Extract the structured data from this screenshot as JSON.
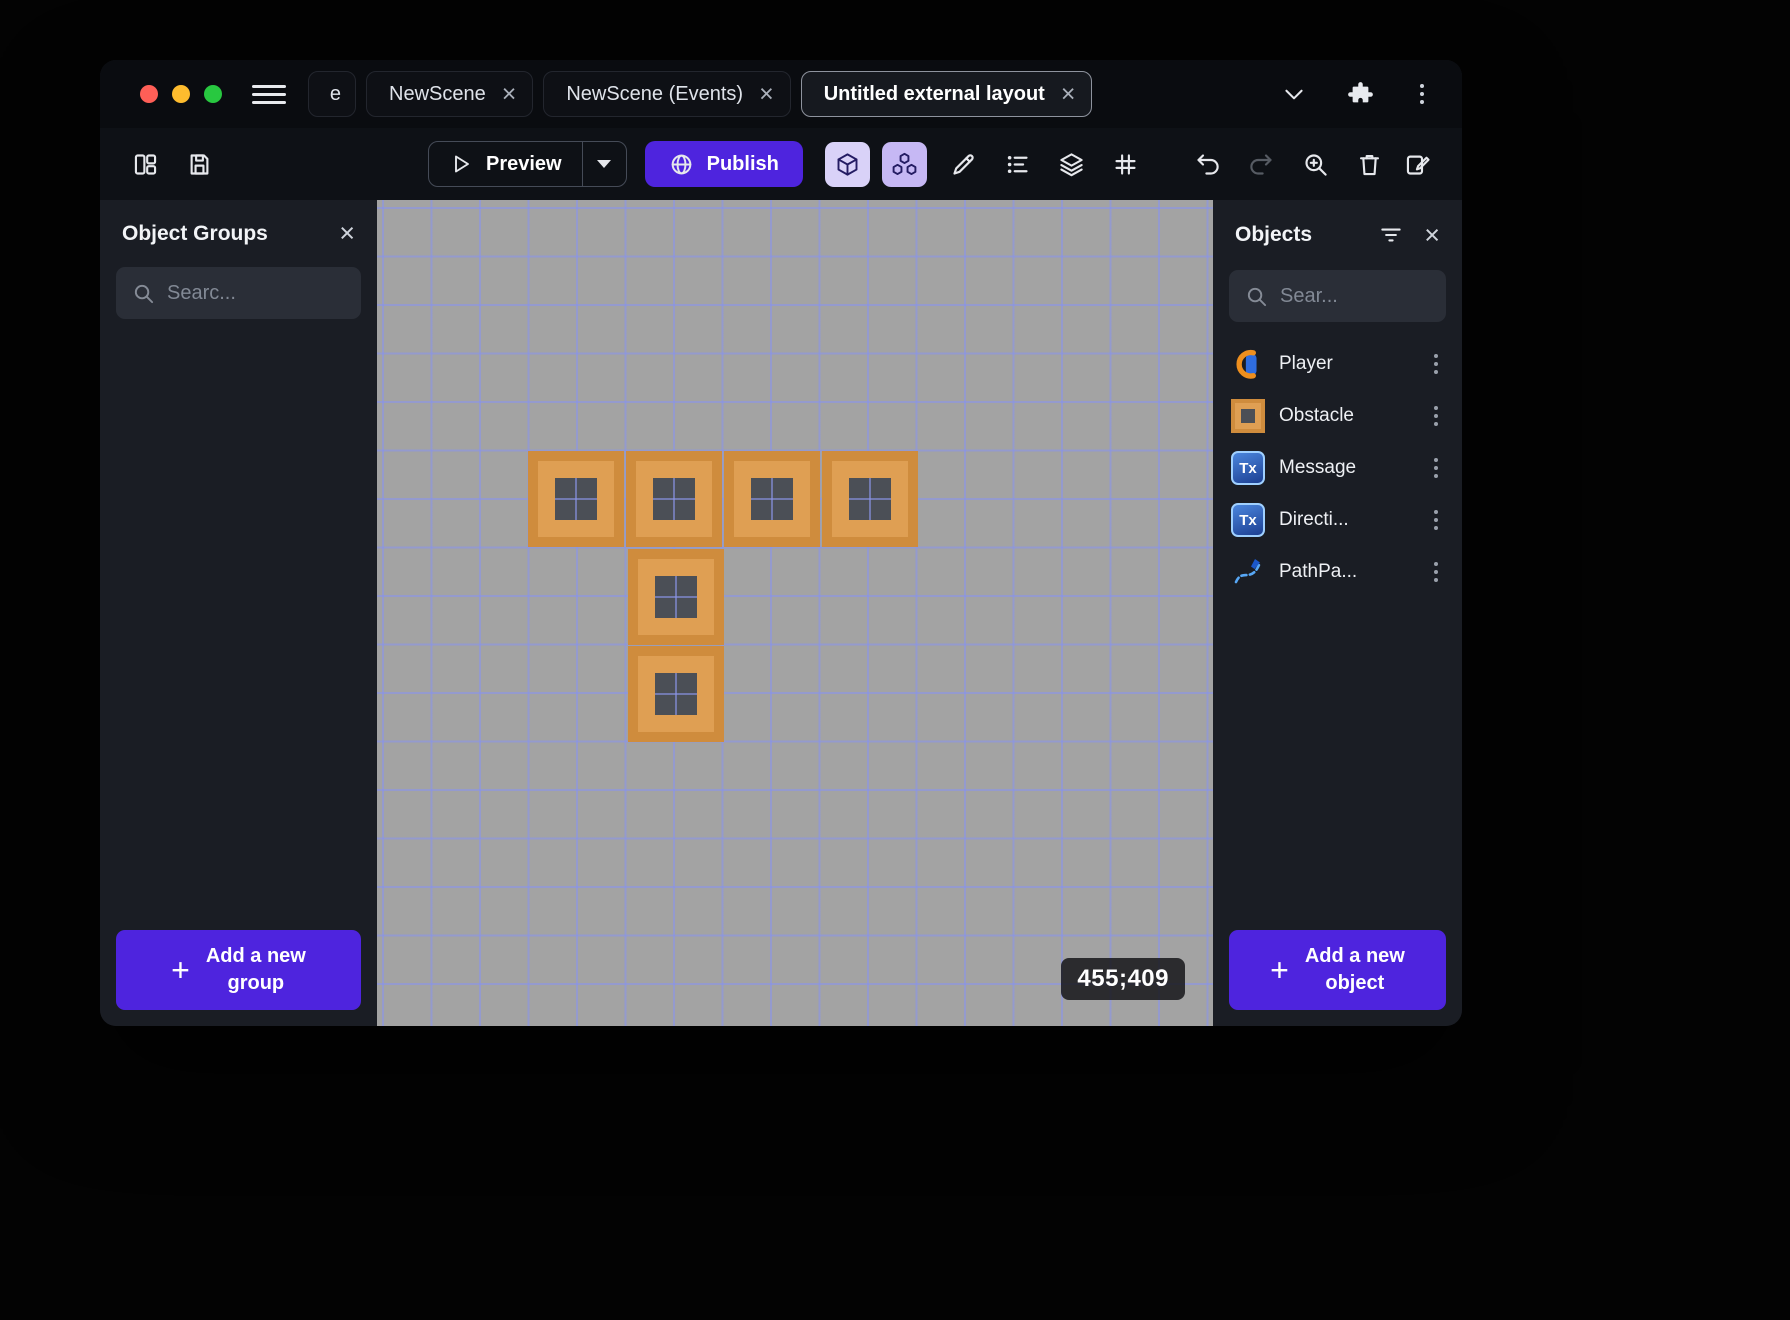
{
  "tabs": {
    "overflow_label": "e",
    "items": [
      {
        "label": "NewScene"
      },
      {
        "label": "NewScene (Events)"
      },
      {
        "label": "Untitled external layout"
      }
    ]
  },
  "toolbar": {
    "preview_label": "Preview",
    "publish_label": "Publish"
  },
  "left_panel": {
    "title": "Object Groups",
    "search_placeholder": "Searc...",
    "add_line1": "Add a new",
    "add_line2": "group"
  },
  "canvas": {
    "coordinate_label": "455;409"
  },
  "right_panel": {
    "title": "Objects",
    "search_placeholder": "Sear...",
    "items": [
      {
        "label": "Player"
      },
      {
        "label": "Obstacle"
      },
      {
        "label": "Message",
        "icon_text": "Tx"
      },
      {
        "label": "Directi...",
        "icon_text": "Tx"
      },
      {
        "label": "PathPa..."
      }
    ],
    "add_line1": "Add a new",
    "add_line2": "object"
  },
  "icons": {
    "close": "×",
    "plus": "+"
  },
  "colors": {
    "accent": "#4e24de",
    "canvas_bg": "#a3a3a3",
    "grid_line": "rgba(134,146,240,0.55)",
    "tile": "#cf8c3d",
    "tile_light": "#df9f53",
    "tile_core": "#4b4f56",
    "traffic_red": "#ff5f57",
    "traffic_yellow": "#febc2e",
    "traffic_green": "#28c840"
  }
}
